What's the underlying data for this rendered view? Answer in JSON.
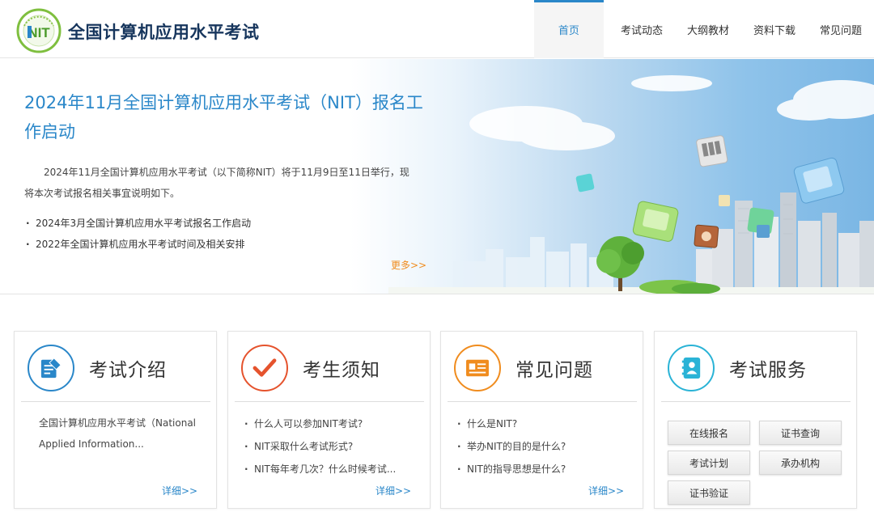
{
  "header": {
    "site_title": "全国计算机应用水平考试",
    "logo_icon": "nit-logo-icon",
    "nav": [
      {
        "label": "首页",
        "active": true
      },
      {
        "label": "考试动态",
        "active": false
      },
      {
        "label": "大纲教材",
        "active": false
      },
      {
        "label": "资料下载",
        "active": false
      },
      {
        "label": "常见问题",
        "active": false
      }
    ]
  },
  "banner": {
    "title": "2024年11月全国计算机应用水平考试（NIT）报名工作启动",
    "description": "2024年11月全国计算机应用水平考试（以下简称NIT）将于11月9日至11日举行，现将本次考试报名相关事宜说明如下。",
    "links": [
      "2024年3月全国计算机应用水平考试报名工作启动",
      "2022年全国计算机应用水平考试时间及相关安排"
    ],
    "more_label": "更多>>"
  },
  "cards": {
    "intro": {
      "title": "考试介绍",
      "icon": "document-pen-icon",
      "text": "全国计算机应用水平考试（National Applied Information...",
      "more_label": "详细>>"
    },
    "notice": {
      "title": "考生须知",
      "icon": "checkmark-icon",
      "items": [
        "什么人可以参加NIT考试?",
        "NIT采取什么考试形式?",
        "NIT每年考几次？什么时候考试..."
      ],
      "more_label": "详细>>"
    },
    "faq": {
      "title": "常见问题",
      "icon": "id-card-icon",
      "items": [
        "什么是NIT?",
        "举办NIT的目的是什么?",
        "NIT的指导思想是什么?"
      ],
      "more_label": "详细>>"
    },
    "service": {
      "title": "考试服务",
      "icon": "contact-book-icon",
      "buttons": [
        "在线报名",
        "证书查询",
        "考试计划",
        "承办机构",
        "证书验证"
      ]
    }
  },
  "colors": {
    "brand_blue": "#2a87c9",
    "title_navy": "#17365d",
    "more_orange": "#f08c1e",
    "check_red": "#e5532d"
  }
}
